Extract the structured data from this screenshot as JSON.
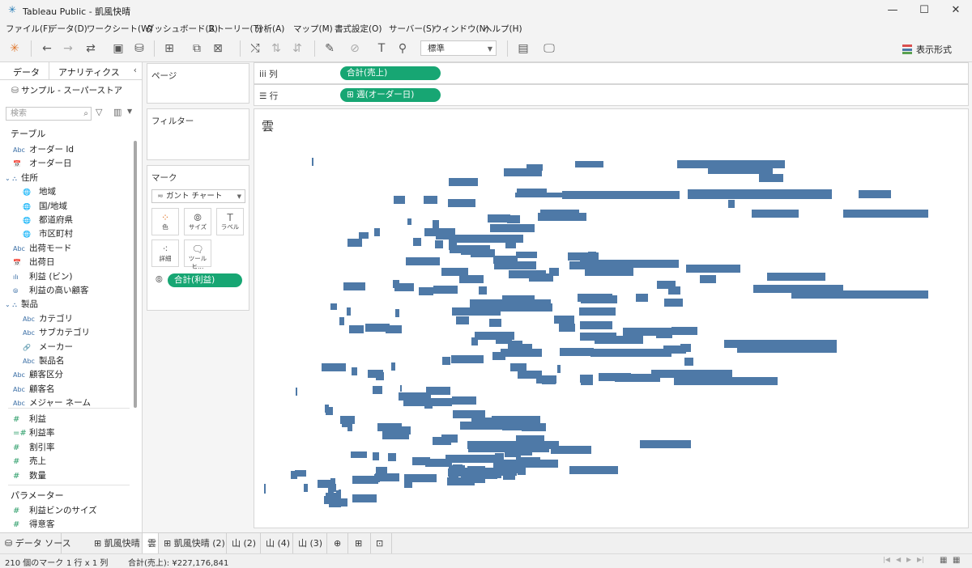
{
  "window": {
    "title": "Tableau Public - 凱風快晴",
    "minimize": "—",
    "maximize": "☐",
    "close": "✕"
  },
  "menu": [
    "ファイル(F)",
    "データ(D)",
    "ワークシート(W)",
    "ダッシュボード(B)",
    "ストーリー(T)",
    "分析(A)",
    "マップ(M)",
    "書式設定(O)",
    "サーバー(S)",
    "ウィンドウ(N)",
    "ヘルプ(H)"
  ],
  "toolbar": {
    "fit_select": "標準",
    "show_me": "表示形式"
  },
  "data_pane": {
    "tab_data": "データ",
    "tab_analytics": "アナリティクス",
    "datasource": "サンプル - スーパーストア",
    "search_placeholder": "検索",
    "section_tables": "テーブル",
    "section_params": "パラメーター",
    "fields": [
      {
        "icon": "Abc",
        "label": "オーダー Id"
      },
      {
        "icon": "📅",
        "label": "オーダー日"
      },
      {
        "icon": "⌄ ⛬",
        "label": "住所"
      },
      {
        "icon": "🌐",
        "label": "地域"
      },
      {
        "icon": "🌐",
        "label": "国/地域"
      },
      {
        "icon": "🌐",
        "label": "都道府県"
      },
      {
        "icon": "🌐",
        "label": "市区町村"
      },
      {
        "icon": "Abc",
        "label": "出荷モード"
      },
      {
        "icon": "📅",
        "label": "出荷日"
      },
      {
        "icon": "ılı",
        "label": "利益 (ビン)"
      },
      {
        "icon": "⦾",
        "label": "利益の高い顧客"
      },
      {
        "icon": "⌄ ⛬",
        "label": "製品"
      },
      {
        "icon": "Abc",
        "label": "カテゴリ"
      },
      {
        "icon": "Abc",
        "label": "サブカテゴリ"
      },
      {
        "icon": "🔗",
        "label": "メーカー"
      },
      {
        "icon": "Abc",
        "label": "製品名"
      },
      {
        "icon": "Abc",
        "label": "顧客区分"
      },
      {
        "icon": "Abc",
        "label": "顧客名"
      },
      {
        "icon": "Abc",
        "label": "メジャー ネーム"
      }
    ],
    "measures": [
      {
        "icon": "#",
        "label": "利益"
      },
      {
        "icon": "=#",
        "label": "利益率"
      },
      {
        "icon": "#",
        "label": "割引率"
      },
      {
        "icon": "#",
        "label": "売上"
      },
      {
        "icon": "#",
        "label": "数量"
      }
    ],
    "params": [
      {
        "icon": "#",
        "label": "利益ビンのサイズ"
      },
      {
        "icon": "#",
        "label": "得意客"
      }
    ]
  },
  "cards": {
    "pages": "ページ",
    "filters": "フィルター",
    "marks": "マーク",
    "mark_type": "ガント チャート",
    "buttons": {
      "color": "色",
      "size": "サイズ",
      "label": "ラベル",
      "detail": "詳細",
      "tooltip": "ツールヒ..."
    },
    "size_pill": "合計(利益)"
  },
  "shelves": {
    "columns_label": "列",
    "columns_pill": "合計(売上)",
    "rows_label": "行",
    "rows_pill": "週(オーダー日)"
  },
  "viz": {
    "title": "雲",
    "mark_color": "#4e79a7"
  },
  "sheet_tabs": [
    "データ ソース",
    "凱風快晴",
    "雲",
    "凱風快晴 (2)",
    "山 (2)",
    "山 (4)",
    "山 (3)"
  ],
  "status": {
    "marks": "210 個のマーク",
    "rows_cols": "1 行 x 1 列",
    "sum": "合計(売上): ¥227,176,841"
  },
  "colors": {
    "pill": "#17a673",
    "mark": "#4e79a7"
  }
}
